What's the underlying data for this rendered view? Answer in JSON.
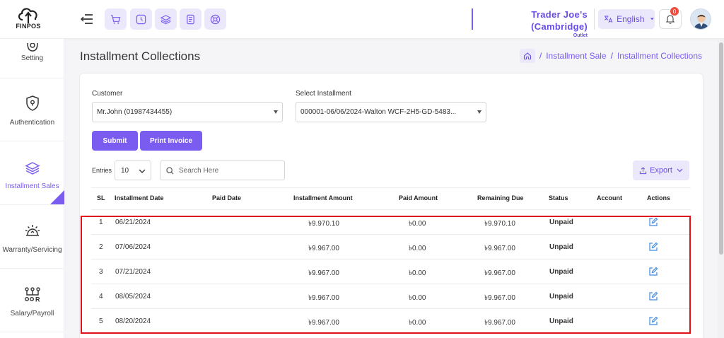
{
  "brand": {
    "name": "FINPOS"
  },
  "header": {
    "store_name": "Trader Joe's (Cambridge)",
    "store_sub": "Outlet",
    "language": "English",
    "notification_count": "0",
    "quick_icons": [
      "cart-icon",
      "clock-icon",
      "layers-icon",
      "receipt-icon",
      "support-icon"
    ]
  },
  "sidebar": {
    "items": [
      {
        "label": "Setting",
        "icon": "gear-icon"
      },
      {
        "label": "Authentication",
        "icon": "shield-icon"
      },
      {
        "label": "Installment Sales",
        "icon": "layers-icon",
        "active": true
      },
      {
        "label": "Warranty/Servicing",
        "icon": "repair-icon"
      },
      {
        "label": "Salary/Payroll",
        "icon": "payroll-icon"
      }
    ]
  },
  "page": {
    "title": "Installment Collections",
    "breadcrumb": [
      "Installment Sale",
      "Installment Collections"
    ],
    "separator": "/"
  },
  "form": {
    "customer_label": "Customer",
    "customer_value": "Mr.John (01987434455)",
    "installment_label": "Select Installment",
    "installment_value": "000001-06/06/2024-Walton WCF-2H5-GD-5483...",
    "submit_label": "Submit",
    "print_label": "Print Invoice"
  },
  "table_controls": {
    "entries_label": "Entries",
    "entries_value": "10",
    "search_placeholder": "Search Here",
    "export_label": "Export"
  },
  "table": {
    "columns": [
      "SL",
      "Installment Date",
      "Paid Date",
      "Installment Amount",
      "Paid Amount",
      "Remaining Due",
      "Status",
      "Account",
      "Actions"
    ],
    "rows": [
      {
        "sl": "1",
        "date": "06/21/2024",
        "paid_date": "",
        "amount": "৳9.970.10",
        "paid": "৳0.00",
        "due": "৳9.970.10",
        "status": "Unpaid",
        "account": ""
      },
      {
        "sl": "2",
        "date": "07/06/2024",
        "paid_date": "",
        "amount": "৳9.967.00",
        "paid": "৳0.00",
        "due": "৳9.967.00",
        "status": "Unpaid",
        "account": ""
      },
      {
        "sl": "3",
        "date": "07/21/2024",
        "paid_date": "",
        "amount": "৳9.967.00",
        "paid": "৳0.00",
        "due": "৳9.967.00",
        "status": "Unpaid",
        "account": ""
      },
      {
        "sl": "4",
        "date": "08/05/2024",
        "paid_date": "",
        "amount": "৳9.967.00",
        "paid": "৳0.00",
        "due": "৳9.967.00",
        "status": "Unpaid",
        "account": ""
      },
      {
        "sl": "5",
        "date": "08/20/2024",
        "paid_date": "",
        "amount": "৳9.967.00",
        "paid": "৳0.00",
        "due": "৳9.967.00",
        "status": "Unpaid",
        "account": ""
      }
    ]
  },
  "colors": {
    "accent": "#7b5cf0",
    "accent_light": "#ece8fb",
    "highlight": "#e0101a",
    "badge": "#f2493d"
  }
}
